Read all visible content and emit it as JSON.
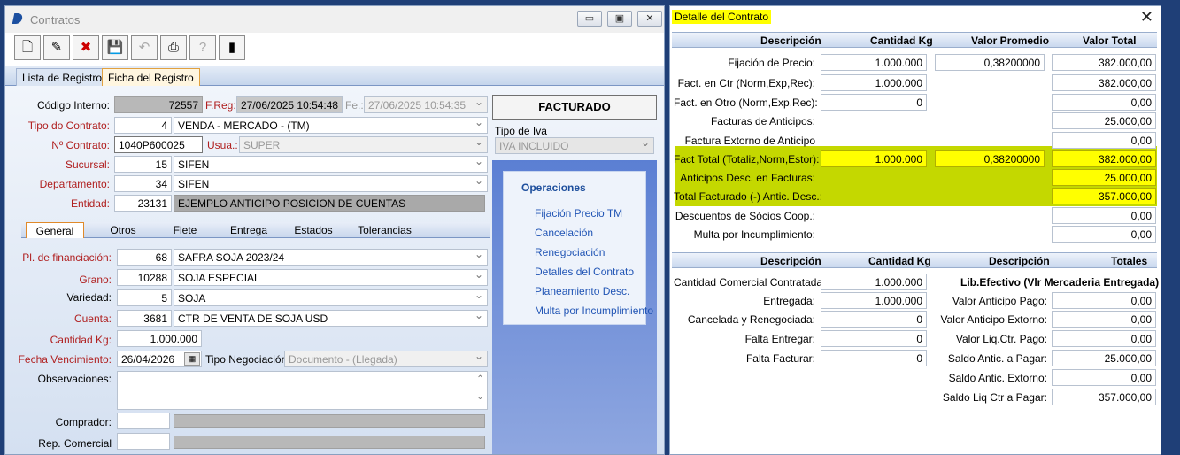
{
  "main_window": {
    "title": "Contratos",
    "controls": [
      "▭",
      "▣",
      "✕"
    ]
  },
  "tabs": [
    "Lista de Registros",
    "Ficha del Registro"
  ],
  "form": {
    "codigo_interno_label": "Código Interno:",
    "codigo_interno": "72557",
    "freg_label": "F.Reg:",
    "freg": "27/06/2025 10:54:48",
    "fe_label": "Fe.:",
    "fe": "27/06/2025 10:54:35",
    "tipo_contrato_label": "Tipo do Contrato:",
    "tipo_contrato_code": "4",
    "tipo_contrato": "VENDA - MERCADO - (TM)",
    "nro_contrato_label": "Nº Contrato:",
    "nro_contrato": "1040P600025",
    "usua_label": "Usua.:",
    "usua": "SUPER",
    "sucursal_label": "Sucursal:",
    "sucursal_code": "15",
    "sucursal": "SIFEN",
    "departamento_label": "Departamento:",
    "departamento_code": "34",
    "departamento": "SIFEN",
    "entidad_label": "Entidad:",
    "entidad_code": "23131",
    "entidad": "EJEMPLO ANTICIPO POSICION DE CUENTAS",
    "status": "FACTURADO",
    "tipo_iva_label": "Tipo de Iva",
    "tipo_iva": "IVA INCLUIDO"
  },
  "subtabs": [
    "General",
    "Otros",
    "Flete",
    "Entrega",
    "Estados",
    "Tolerancias"
  ],
  "general": {
    "pl_financiacion_label": "Pl. de financiación:",
    "pl_financiacion_code": "68",
    "pl_financiacion": "SAFRA SOJA 2023/24",
    "grano_label": "Grano:",
    "grano_code": "10288",
    "grano": "SOJA ESPECIAL",
    "variedad_label": "Variedad:",
    "variedad_code": "5",
    "variedad": "SOJA",
    "cuenta_label": "Cuenta:",
    "cuenta_code": "3681",
    "cuenta": "CTR DE VENTA DE SOJA USD",
    "cantidad_kg_label": "Cantidad Kg:",
    "cantidad_kg": "1.000.000",
    "fecha_venc_label": "Fecha Vencimiento:",
    "fecha_venc": "26/04/2026",
    "tipo_negociacion_label": "Tipo Negociación:",
    "tipo_negociacion": "Documento - (Llegada)",
    "observaciones_label": "Observaciones:",
    "comprador_label": "Comprador:",
    "rep_comercial_label": "Rep. Comercial"
  },
  "operaciones": {
    "title": "Operaciones",
    "links": [
      "Fijación Precio TM",
      "Cancelación",
      "Renegociación",
      "Detalles del Contrato",
      "Planeamiento Desc.",
      "Multa por Incumplimiento"
    ]
  },
  "detalle": {
    "title": "Detalle del Contrato",
    "close": "✕",
    "headers1": [
      "Descripción",
      "Cantidad Kg",
      "Valor Promedio",
      "Valor Total"
    ],
    "rows1": [
      {
        "label": "Fijación de Precio:",
        "kg": "1.000.000",
        "prom": "0,38200000",
        "total": "382.000,00"
      },
      {
        "label": "Fact. en Ctr (Norm,Exp,Rec):",
        "kg": "1.000.000",
        "prom": "",
        "total": "382.000,00"
      },
      {
        "label": "Fact. en Otro (Norm,Exp,Rec):",
        "kg": "0",
        "prom": "",
        "total": "0,00"
      },
      {
        "label": "Facturas de Anticipos:",
        "kg": "",
        "prom": "",
        "total": "25.000,00"
      },
      {
        "label": "Factura Extorno de Anticipo",
        "kg": "",
        "prom": "",
        "total": "0,00"
      },
      {
        "label": "Fact Total (Totaliz,Norm,Estor):",
        "kg": "1.000.000",
        "prom": "0,38200000",
        "total": "382.000,00"
      },
      {
        "label": "Anticipos Desc. en Facturas:",
        "kg": "",
        "prom": "",
        "total": "25.000,00"
      },
      {
        "label": "Total Facturado (-) Antic. Desc.:",
        "kg": "",
        "prom": "",
        "total": "357.000,00"
      },
      {
        "label": "Descuentos de Sócios Coop.:",
        "kg": "",
        "prom": "",
        "total": "0,00"
      },
      {
        "label": "Multa por Incumplimiento:",
        "kg": "",
        "prom": "",
        "total": "0,00"
      }
    ],
    "headers2": [
      "Descripción",
      "Cantidad Kg",
      "Descripción",
      "Totales"
    ],
    "lib_title": "Lib.Efectivo (Vlr Mercaderia Entregada)",
    "rows2_left": [
      {
        "label": "Cantidad Comercial Contratada:",
        "kg": "1.000.000"
      },
      {
        "label": "Entregada:",
        "kg": "1.000.000"
      },
      {
        "label": "Cancelada y Renegociada:",
        "kg": "0"
      },
      {
        "label": "Falta Entregar:",
        "kg": "0"
      },
      {
        "label": "Falta Facturar:",
        "kg": "0"
      }
    ],
    "rows2_right": [
      {
        "label": "Valor Anticipo Pago:",
        "val": "0,00"
      },
      {
        "label": "Valor Anticipo Extorno:",
        "val": "0,00"
      },
      {
        "label": "Valor Liq.Ctr. Pago:",
        "val": "0,00"
      },
      {
        "label": "Saldo Antic. a Pagar:",
        "val": "25.000,00"
      },
      {
        "label": "Saldo Antic. Extorno:",
        "val": "0,00"
      },
      {
        "label": "Saldo Liq Ctr a Pagar:",
        "val": "357.000,00"
      }
    ]
  }
}
